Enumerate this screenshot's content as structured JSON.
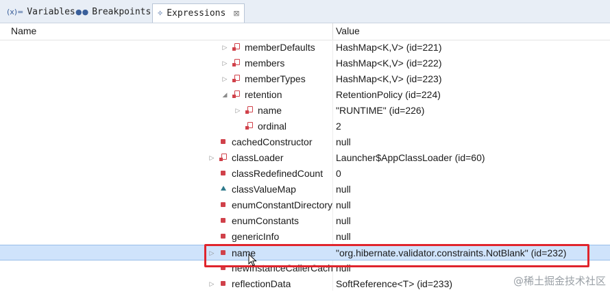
{
  "tabs": [
    {
      "label": "Variables",
      "icon": "variables-icon",
      "glyph": "(x)="
    },
    {
      "label": "Breakpoints",
      "icon": "breakpoints-icon",
      "glyph": "●●"
    },
    {
      "label": "Expressions",
      "icon": "expressions-icon",
      "glyph": "✧",
      "close": "⊠"
    }
  ],
  "table": {
    "headers": {
      "name": "Name",
      "value": "Value"
    },
    "rows": [
      {
        "name": "memberDefaults",
        "value": "HashMap<K,V>  (id=221)",
        "expander": "▷",
        "kind": "flag",
        "indent": 1
      },
      {
        "name": "members",
        "value": "HashMap<K,V>  (id=222)",
        "expander": "▷",
        "kind": "flag",
        "indent": 1
      },
      {
        "name": "memberTypes",
        "value": "HashMap<K,V>  (id=223)",
        "expander": "▷",
        "kind": "flag",
        "indent": 1
      },
      {
        "name": "retention",
        "value": "RetentionPolicy  (id=224)",
        "expander": "◢",
        "kind": "flag",
        "indent": 1
      },
      {
        "name": "name",
        "value": "\"RUNTIME\" (id=226)",
        "expander": "▷",
        "kind": "flag",
        "indent": 2
      },
      {
        "name": "ordinal",
        "value": "2",
        "expander": "",
        "kind": "flag",
        "indent": 2
      },
      {
        "name": "cachedConstructor",
        "value": "null",
        "expander": "",
        "kind": "square",
        "indent": 0
      },
      {
        "name": "classLoader",
        "value": "Launcher$AppClassLoader  (id=60)",
        "expander": "▷",
        "kind": "flag",
        "indent": 0
      },
      {
        "name": "classRedefinedCount",
        "value": "0",
        "expander": "",
        "kind": "square",
        "indent": 0
      },
      {
        "name": "classValueMap",
        "value": "null",
        "expander": "",
        "kind": "triangle",
        "indent": 0
      },
      {
        "name": "enumConstantDirectory",
        "value": "null",
        "expander": "",
        "kind": "square",
        "indent": 0
      },
      {
        "name": "enumConstants",
        "value": "null",
        "expander": "",
        "kind": "square",
        "indent": 0
      },
      {
        "name": "genericInfo",
        "value": "null",
        "expander": "",
        "kind": "square",
        "indent": 0
      },
      {
        "name": "name",
        "value": "\"org.hibernate.validator.constraints.NotBlank\" (id=232)",
        "expander": "▷",
        "kind": "square",
        "indent": 0,
        "selected": true
      },
      {
        "name": "newInstanceCallerCache",
        "value": "null",
        "expander": "",
        "kind": "square",
        "indent": 0
      },
      {
        "name": "reflectionData",
        "value": "SoftReference<T>  (id=233)",
        "expander": "▷",
        "kind": "square",
        "indent": 0
      }
    ]
  },
  "watermark": "@稀土掘金技术社区",
  "colors": {
    "selection": "#cfe3fb",
    "highlight_border": "#e0242c",
    "field_icon": "#d0414a"
  }
}
